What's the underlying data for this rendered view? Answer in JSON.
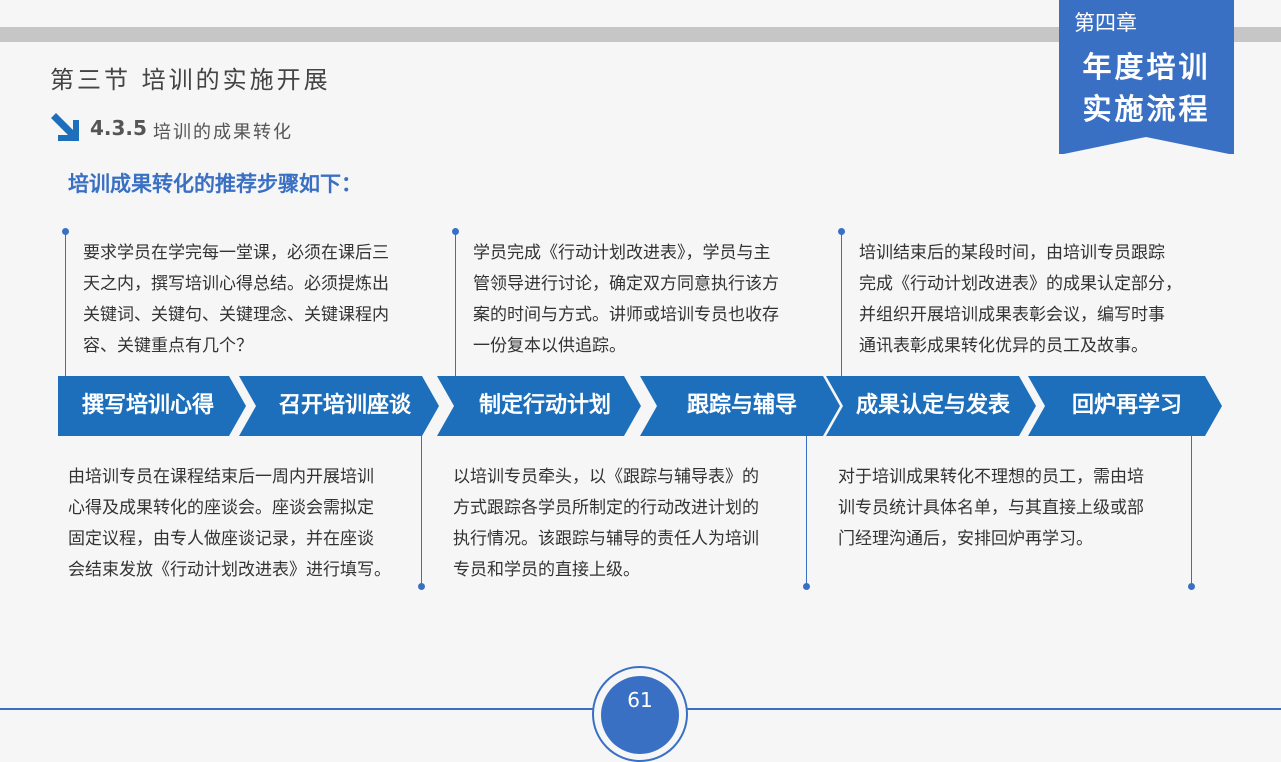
{
  "chapter": {
    "label": "第四章",
    "title_line1": "年度培训",
    "title_line2": "实施流程"
  },
  "section_title": "第三节  培训的实施开展",
  "subsection": {
    "number": "4.3.5",
    "text": "培训的成果转化"
  },
  "lead_text": "培训成果转化的推荐步骤如下：",
  "steps": [
    {
      "label": "撰写培训心得"
    },
    {
      "label": "召开培训座谈"
    },
    {
      "label": "制定行动计划"
    },
    {
      "label": "跟踪与辅导"
    },
    {
      "label": "成果认定与发表"
    },
    {
      "label": "回炉再学习"
    }
  ],
  "descriptions": {
    "step1": [
      "要求学员在学完每一堂课，必须在课后三",
      "天之内，撰写培训心得总结。必须提炼出",
      "关键词、关键句、关键理念、关键课程内",
      "容、关键重点有几个？"
    ],
    "step2": [
      "由培训专员在课程结束后一周内开展培训",
      "心得及成果转化的座谈会。座谈会需拟定",
      "固定议程，由专人做座谈记录，并在座谈",
      "会结束发放《行动计划改进表》进行填写。"
    ],
    "step3": [
      "学员完成《行动计划改进表》，学员与主",
      "管领导进行讨论，确定双方同意执行该方",
      "案的时间与方式。讲师或培训专员也收存",
      "一份复本以供追踪。"
    ],
    "step4": [
      "以培训专员牵头，以《跟踪与辅导表》的",
      "方式跟踪各学员所制定的行动改进计划的",
      "执行情况。该跟踪与辅导的责任人为培训",
      "专员和学员的直接上级。"
    ],
    "step5": [
      "培训结束后的某段时间，由培训专员跟踪",
      "完成《行动计划改进表》的成果认定部分，",
      "并组织开展培训成果表彰会议，编写时事",
      "通讯表彰成果转化优异的员工及故事。"
    ],
    "step6": [
      "对于培训成果转化不理想的员工，需由培",
      "训专员统计具体名单，与其直接上级或部",
      "门经理沟通后，安排回炉再学习。"
    ]
  },
  "page_number": "61",
  "colors": {
    "accent": "#3a70c4",
    "arrow": "#1d6fbb",
    "text": "#333333"
  }
}
